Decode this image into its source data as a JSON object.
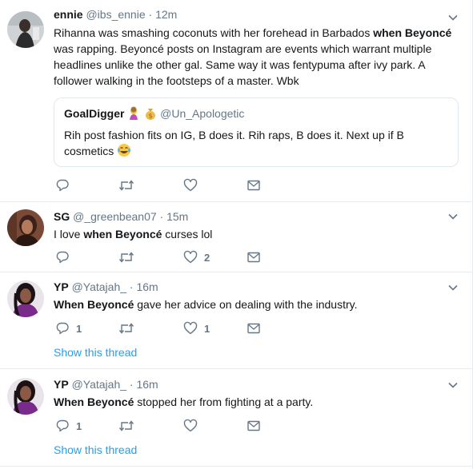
{
  "tweets": [
    {
      "name": "ennie",
      "handle": "@ibs_ennie",
      "dot": "·",
      "time": "12m",
      "text_before": "Rihanna was smashing coconuts with her forehead in Barbados ",
      "text_bold": "when Beyoncé",
      "text_after": " was rapping. Beyoncé posts on Instagram are events which warrant multiple headlines unlike the other gal. Same way it was fentypuma after ivy park. A follower walking in the footsteps of a master. Wbk",
      "quote": {
        "name": "GoalDigger",
        "handle": "@Un_Apologetic",
        "text": "Rih post fashion fits on IG, B does it.  Rih raps, B does it. Next up if B cosmetics"
      },
      "reply_count": "",
      "retweet_count": "",
      "like_count": ""
    },
    {
      "name": "SG",
      "handle": "@_greenbean07",
      "dot": "·",
      "time": "15m",
      "text_before": "I love ",
      "text_bold": "when Beyoncé",
      "text_after": " curses lol",
      "reply_count": "",
      "retweet_count": "",
      "like_count": "2"
    },
    {
      "name": "YP",
      "handle": "@Yatajah_",
      "dot": "·",
      "time": "16m",
      "text_before": "",
      "text_bold": "When Beyoncé",
      "text_after": " gave her advice on dealing with the industry.",
      "reply_count": "1",
      "retweet_count": "",
      "like_count": "1",
      "show_thread": "Show this thread"
    },
    {
      "name": "YP",
      "handle": "@Yatajah_",
      "dot": "·",
      "time": "16m",
      "text_before": "",
      "text_bold": "When Beyoncé",
      "text_after": " stopped her from fighting at a party.",
      "reply_count": "1",
      "retweet_count": "",
      "like_count": "",
      "show_thread": "Show this thread"
    }
  ],
  "icons": {
    "reply": "reply-icon",
    "retweet": "retweet-icon",
    "like": "heart-icon",
    "message": "envelope-icon",
    "more": "chevron-down-icon"
  },
  "colors": {
    "link": "#1da1f2",
    "secondary_text": "#657786",
    "icon": "#657786",
    "border": "#e6ecf0"
  }
}
